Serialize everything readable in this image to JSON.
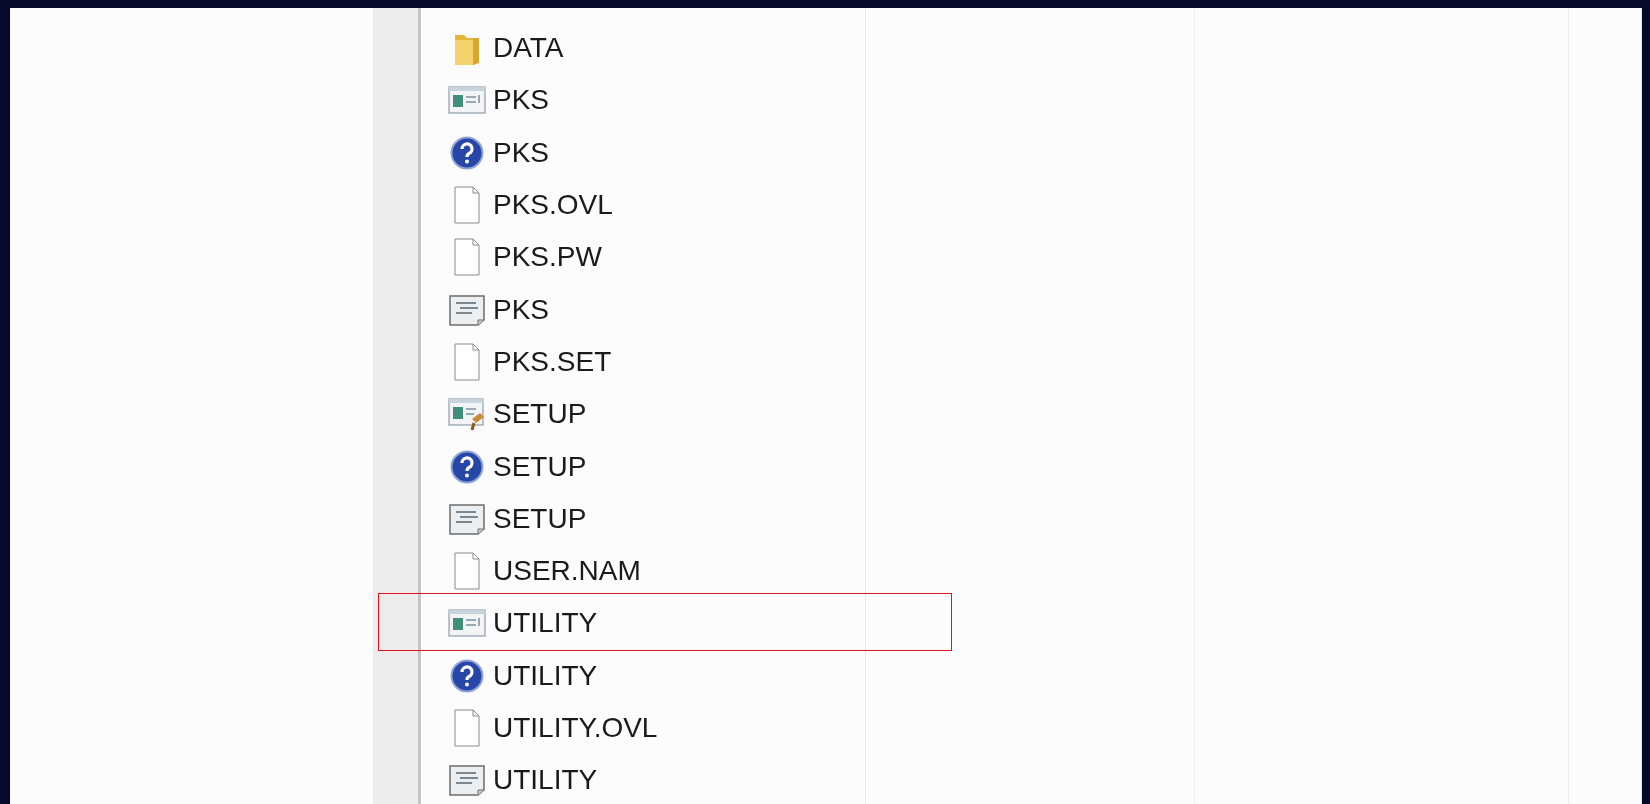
{
  "files": [
    {
      "name": "DATA",
      "kind": "folder",
      "highlighted": false
    },
    {
      "name": "PKS",
      "kind": "app",
      "highlighted": false
    },
    {
      "name": "PKS",
      "kind": "help",
      "highlighted": false
    },
    {
      "name": "PKS.OVL",
      "kind": "blank",
      "highlighted": false
    },
    {
      "name": "PKS.PW",
      "kind": "blank",
      "highlighted": false
    },
    {
      "name": "PKS",
      "kind": "config",
      "highlighted": false
    },
    {
      "name": "PKS.SET",
      "kind": "blank",
      "highlighted": false
    },
    {
      "name": "SETUP",
      "kind": "setup",
      "highlighted": false
    },
    {
      "name": "SETUP",
      "kind": "help",
      "highlighted": false
    },
    {
      "name": "SETUP",
      "kind": "config",
      "highlighted": false
    },
    {
      "name": "USER.NAM",
      "kind": "blank",
      "highlighted": false
    },
    {
      "name": "UTILITY",
      "kind": "app",
      "highlighted": true
    },
    {
      "name": "UTILITY",
      "kind": "help",
      "highlighted": false
    },
    {
      "name": "UTILITY.OVL",
      "kind": "blank",
      "highlighted": false
    },
    {
      "name": "UTILITY",
      "kind": "config",
      "highlighted": false
    }
  ]
}
